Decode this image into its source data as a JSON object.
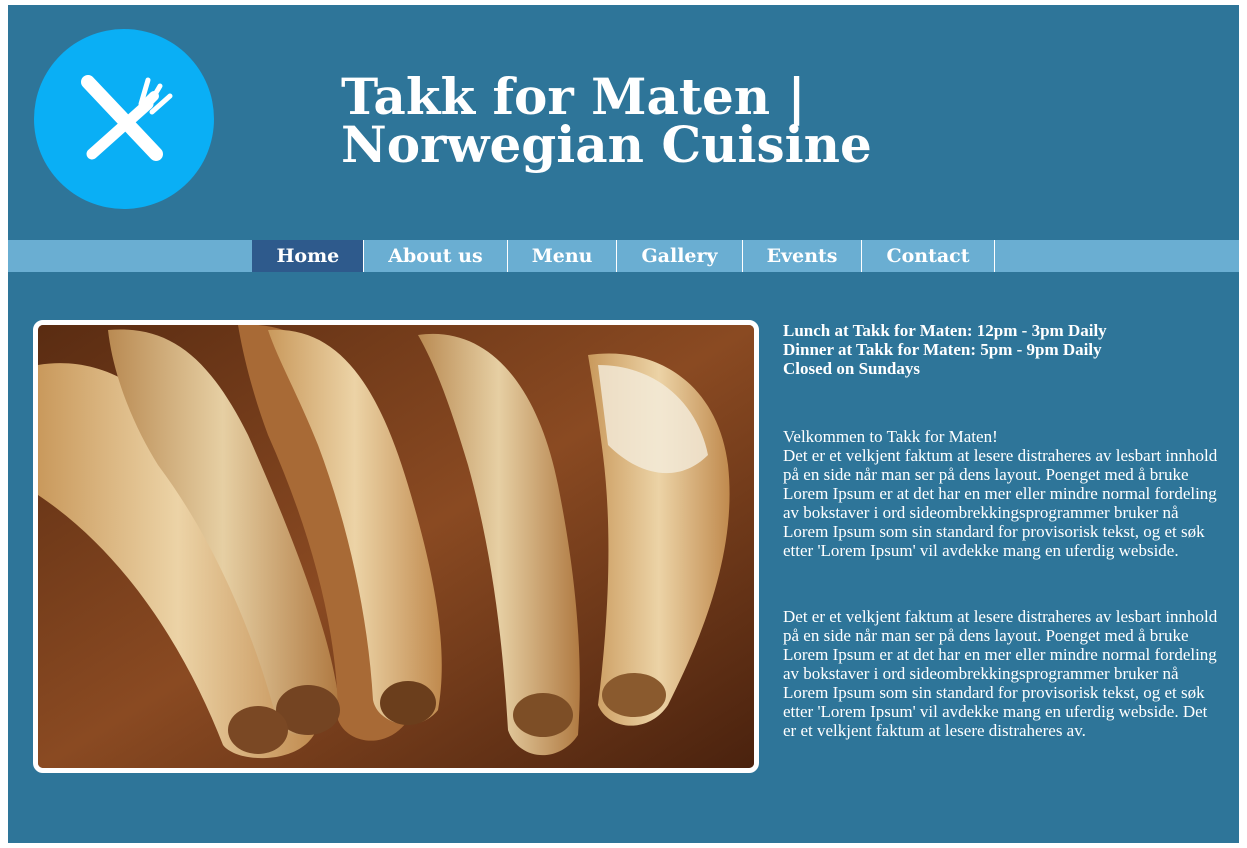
{
  "header": {
    "title": "Takk for Maten | Norwegian Cuisine",
    "logo_icon": "fork-and-knife-icon"
  },
  "nav": {
    "items": [
      "Home",
      "About us",
      "Menu",
      "Gallery",
      "Events",
      "Contact"
    ],
    "active": "Home"
  },
  "hours": {
    "lunch": "Lunch at Takk for Maten: 12pm - 3pm Daily",
    "dinner": "Dinner at Takk for Maten: 5pm - 9pm Daily",
    "closed": "Closed on Sundays"
  },
  "intro": {
    "welcome": "Velkommen to Takk for Maten!",
    "body": "Det er et velkjent faktum at lesere distraheres av lesbart innhold på en side når man ser på dens layout. Poenget med å bruke Lorem Ipsum er at det har en mer eller mindre normal fordeling av bokstaver i ord sideombrekkingsprogrammer bruker nå Lorem Ipsum som sin standard for provisorisk tekst, og et søk etter 'Lorem Ipsum' vil avdekke mang en uferdig webside."
  },
  "second_paragraph": "Det er et velkjent faktum at lesere distraheres av lesbart innhold på en side når man ser på dens layout. Poenget med å bruke Lorem Ipsum er at det har en mer eller mindre normal fordeling av bokstaver i ord sideombrekkingsprogrammer bruker nå Lorem Ipsum som sin standard for provisorisk tekst, og et søk etter 'Lorem Ipsum' vil avdekke mang en uferdig webside. Det er et velkjent faktum at lesere distraheres av.",
  "colors": {
    "page_background": "#2e7599",
    "nav_bar": "#6aaed2",
    "nav_active": "#2e5a8c",
    "logo_circle": "#0aaff5",
    "text": "#ffffff"
  }
}
